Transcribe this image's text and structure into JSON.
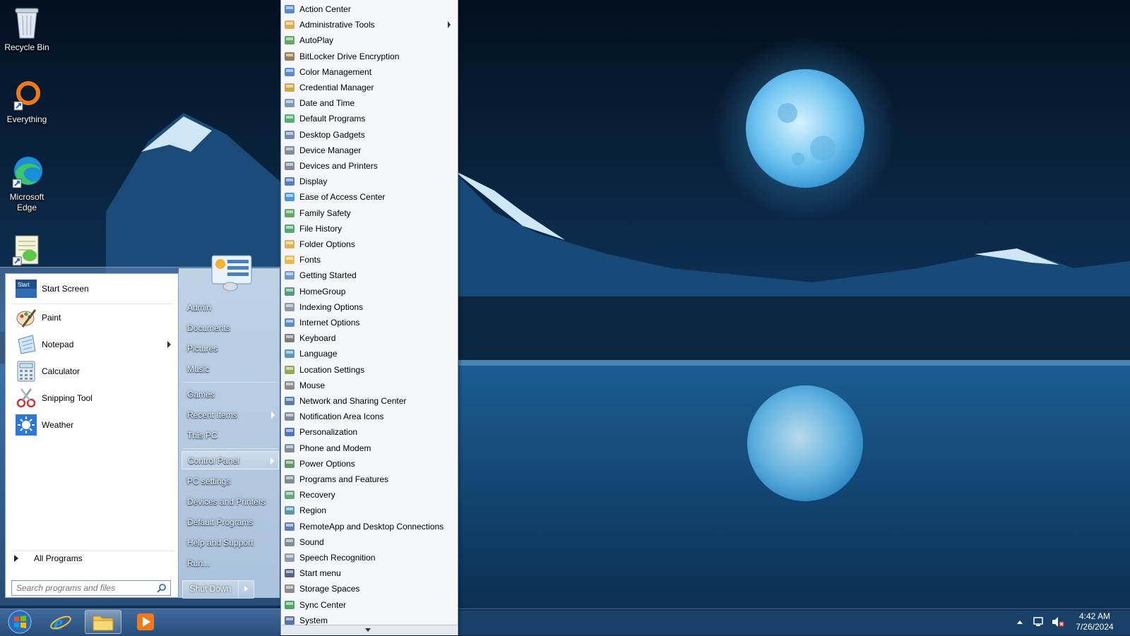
{
  "desktop": {
    "icons": [
      {
        "label": "Recycle Bin"
      },
      {
        "label": "Everything"
      },
      {
        "label": "Microsoft Edge"
      },
      {
        "label": ""
      }
    ]
  },
  "start_menu": {
    "pinned": [
      {
        "label": "Start Screen",
        "icon": "start-screen-icon"
      },
      {
        "label": "Paint",
        "icon": "paint-icon"
      },
      {
        "label": "Notepad",
        "icon": "notepad-icon"
      },
      {
        "label": "Calculator",
        "icon": "calculator-icon"
      },
      {
        "label": "Snipping Tool",
        "icon": "snipping-tool-icon"
      },
      {
        "label": "Weather",
        "icon": "weather-icon"
      }
    ],
    "start_badge": "Start",
    "all_programs": "All Programs",
    "search_placeholder": "Search programs and files",
    "right_links": [
      {
        "label": "Admin"
      },
      {
        "label": "Documents"
      },
      {
        "label": "Pictures"
      },
      {
        "label": "Music"
      },
      {
        "label": "Games"
      },
      {
        "label": "Recent Items"
      },
      {
        "label": "This PC"
      },
      {
        "label": "Control Panel"
      },
      {
        "label": "PC settings"
      },
      {
        "label": "Devices and Printers"
      },
      {
        "label": "Default Programs"
      },
      {
        "label": "Help and Support"
      },
      {
        "label": "Run..."
      }
    ],
    "shutdown_label": "Shut Down"
  },
  "control_panel_menu": {
    "items": [
      {
        "label": "Action Center"
      },
      {
        "label": "Administrative Tools"
      },
      {
        "label": "AutoPlay"
      },
      {
        "label": "BitLocker Drive Encryption"
      },
      {
        "label": "Color Management"
      },
      {
        "label": "Credential Manager"
      },
      {
        "label": "Date and Time"
      },
      {
        "label": "Default Programs"
      },
      {
        "label": "Desktop Gadgets"
      },
      {
        "label": "Device Manager"
      },
      {
        "label": "Devices and Printers"
      },
      {
        "label": "Display"
      },
      {
        "label": "Ease of Access Center"
      },
      {
        "label": "Family Safety"
      },
      {
        "label": "File History"
      },
      {
        "label": "Folder Options"
      },
      {
        "label": "Fonts"
      },
      {
        "label": "Getting Started"
      },
      {
        "label": "HomeGroup"
      },
      {
        "label": "Indexing Options"
      },
      {
        "label": "Internet Options"
      },
      {
        "label": "Keyboard"
      },
      {
        "label": "Language"
      },
      {
        "label": "Location Settings"
      },
      {
        "label": "Mouse"
      },
      {
        "label": "Network and Sharing Center"
      },
      {
        "label": "Notification Area Icons"
      },
      {
        "label": "Personalization"
      },
      {
        "label": "Phone and Modem"
      },
      {
        "label": "Power Options"
      },
      {
        "label": "Programs and Features"
      },
      {
        "label": "Recovery"
      },
      {
        "label": "Region"
      },
      {
        "label": "RemoteApp and Desktop Connections"
      },
      {
        "label": "Sound"
      },
      {
        "label": "Speech Recognition"
      },
      {
        "label": "Start menu"
      },
      {
        "label": "Storage Spaces"
      },
      {
        "label": "Sync Center"
      },
      {
        "label": "System"
      }
    ]
  },
  "taskbar": {
    "clock_time": "4:42 AM",
    "clock_date": "7/26/2024"
  },
  "colors": {
    "accent": "#3a78c8",
    "menu_bg": "#f4f6f9",
    "taskbar": "#2d5a8c"
  }
}
